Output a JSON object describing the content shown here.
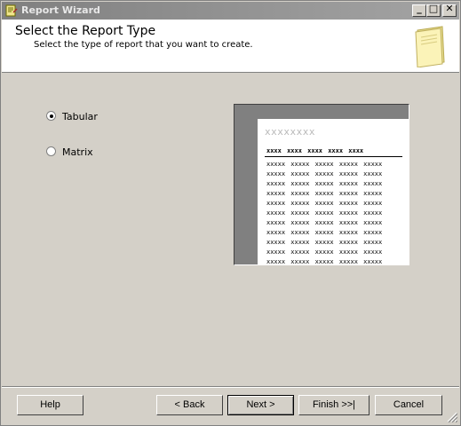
{
  "window": {
    "title": "Report Wizard",
    "minimize_glyph": "_",
    "maximize_glyph": "□",
    "close_glyph": "✕"
  },
  "header": {
    "title": "Select the Report Type",
    "subtitle": "Select the type of report that you want to create."
  },
  "options": [
    {
      "label": "Tabular",
      "selected": true
    },
    {
      "label": "Matrix",
      "selected": false
    }
  ],
  "preview": {
    "title_text": "xxxxxxxx",
    "header_row": "xxxx xxxx xxxx xxxx xxxx",
    "data_row": "xxxxx xxxxx xxxxx xxxxx xxxxx"
  },
  "buttons": {
    "help": "Help",
    "back": "< Back",
    "next": "Next >",
    "finish": "Finish >>|",
    "cancel": "Cancel"
  }
}
